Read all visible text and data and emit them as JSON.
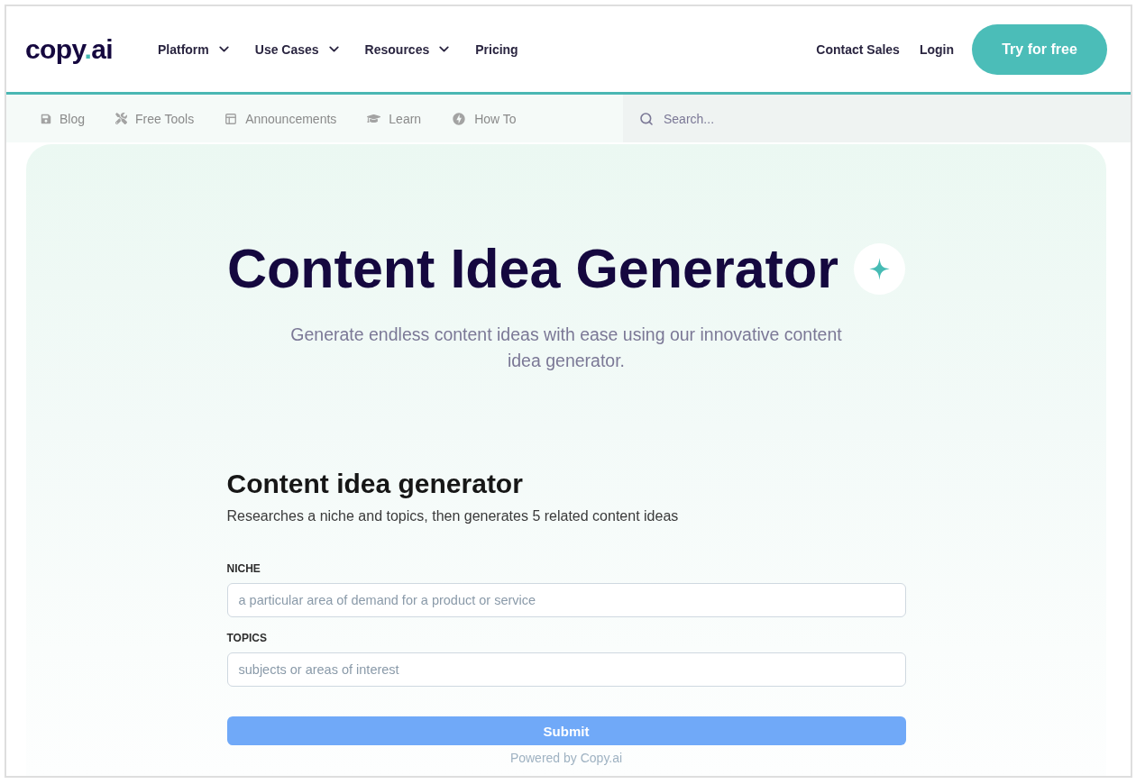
{
  "header": {
    "logo": {
      "word": "copy",
      "dot": ".",
      "suffix": "ai"
    },
    "nav": [
      {
        "label": "Platform",
        "kind": "dropdown"
      },
      {
        "label": "Use Cases",
        "kind": "dropdown"
      },
      {
        "label": "Resources",
        "kind": "dropdown"
      },
      {
        "label": "Pricing",
        "kind": "link"
      }
    ],
    "actions": [
      {
        "label": "Contact Sales",
        "kind": "link"
      },
      {
        "label": "Login",
        "kind": "link"
      },
      {
        "label": "Try for free",
        "kind": "button"
      }
    ]
  },
  "subnav": {
    "items": [
      {
        "label": "Blog"
      },
      {
        "label": "Free Tools"
      },
      {
        "label": "Announcements"
      },
      {
        "label": "Learn"
      },
      {
        "label": "How To"
      }
    ],
    "search": {
      "placeholder": "Search..."
    }
  },
  "hero": {
    "title": "Content Idea Generator",
    "subtitle": "Generate endless content ideas with ease using our innovative content idea generator."
  },
  "tool": {
    "heading": "Content idea generator",
    "description": "Researches a niche and topics, then generates 5 related content ideas",
    "fields": [
      {
        "label": "NICHE",
        "placeholder": "a particular area of demand for a product or service"
      },
      {
        "label": "TOPICS",
        "placeholder": "subjects or areas of interest"
      }
    ],
    "submit": "Submit",
    "footer": "Powered by Copy.ai"
  }
}
